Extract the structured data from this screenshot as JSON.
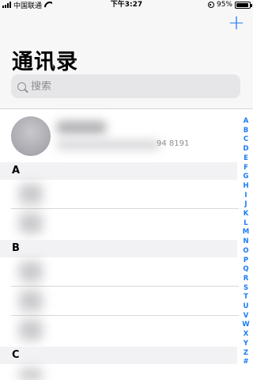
{
  "status_bar": {
    "carrier": "中国联通",
    "time": "下午3:27",
    "battery_percent": "95%",
    "battery_level": 0.95
  },
  "header": {
    "add_label": "+",
    "title": "通讯录"
  },
  "search": {
    "placeholder": "搜索"
  },
  "my_card": {
    "phone_partial": "94 8191"
  },
  "sections": [
    {
      "letter": "A",
      "rows": [
        {
          "char": ""
        },
        {
          "char": ""
        }
      ]
    },
    {
      "letter": "B",
      "rows": [
        {
          "char": ""
        },
        {
          "char": ""
        },
        {
          "char": ""
        }
      ]
    },
    {
      "letter": "C",
      "rows": [
        {
          "char": ""
        }
      ]
    }
  ],
  "index_letters": [
    "A",
    "B",
    "C",
    "D",
    "E",
    "F",
    "G",
    "H",
    "I",
    "J",
    "K",
    "L",
    "M",
    "N",
    "O",
    "P",
    "Q",
    "R",
    "S",
    "T",
    "U",
    "V",
    "W",
    "X",
    "Y",
    "Z",
    "#"
  ],
  "colors": {
    "accent": "#1a7cf5",
    "section_bg": "#f2f2f4",
    "header_bg": "#f7f7f7"
  }
}
